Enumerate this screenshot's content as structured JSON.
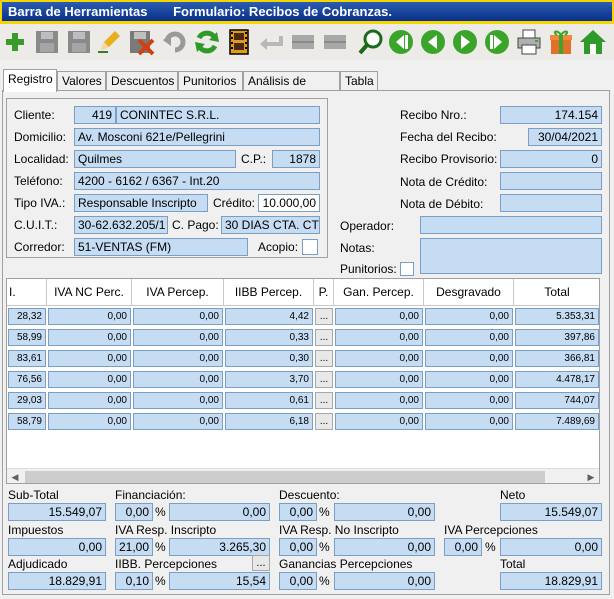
{
  "title": {
    "left": "Barra de Herramientas",
    "right": "Formulario: Recibos de Cobranzas."
  },
  "toolbar": {
    "icons": [
      "add-icon",
      "disabled-save-icon",
      "disabled-save-icon",
      "edit-icon",
      "delete-icon",
      "undo-icon",
      "refresh-icon",
      "film-icon",
      "back-arrow-icon",
      "disabled-icon",
      "disabled-icon",
      "search-icon",
      "first-record-icon",
      "previous-record-icon",
      "next-record-icon",
      "last-record-icon",
      "print-icon",
      "gift-icon",
      "home-icon"
    ]
  },
  "tabs": [
    "Registro",
    "Valores",
    "Descuentos",
    "Punitorios",
    "Análisis de Pago",
    "Tabla"
  ],
  "form": {
    "cliente_label": "Cliente:",
    "cliente_code": "419",
    "cliente_name": "CONINTEC S.R.L.",
    "domicilio_label": "Domicilio:",
    "domicilio": "Av. Mosconi 621e/Pellegrini",
    "localidad_label": "Localidad:",
    "localidad": "Quilmes",
    "cp_label": "C.P.:",
    "cp": "1878",
    "telefono_label": "Teléfono:",
    "telefono": "4200 - 6162 / 6367 - Int.20",
    "tipo_iva_label": "Tipo IVA.:",
    "tipo_iva": "Responsable Inscripto",
    "credito_label": "Crédito:",
    "credito": "10.000,00",
    "cuit_label": "C.U.I.T.:",
    "cuit": "30-62.632.205/1",
    "cpago_label": "C. Pago:",
    "cpago": "30 DIAS CTA. CTE",
    "corredor_label": "Corredor:",
    "corredor": "51-VENTAS (FM)",
    "acopio_label": "Acopio:",
    "recibo_nro_label": "Recibo Nro.:",
    "recibo_nro": "174.154",
    "fecha_label": "Fecha del Recibo:",
    "fecha": "30/04/2021",
    "provisorio_label": "Recibo Provisorio:",
    "provisorio": "0",
    "nota_credito_label": "Nota de Crédito:",
    "nota_credito": "",
    "nota_debito_label": "Nota de Débito:",
    "nota_debito": "",
    "operador_label": "Operador:",
    "notas_label": "Notas:",
    "punitorios_label": "Punitorios:"
  },
  "grid": {
    "headers": [
      "I.",
      "IVA NC Perc.",
      "IVA Percep.",
      "IIBB Percep.",
      "P.",
      "Gan. Percep.",
      "Desgravado",
      "Total"
    ],
    "rows": [
      [
        "28,32",
        "0,00",
        "0,00",
        "4,42",
        "...",
        "0,00",
        "0,00",
        "5.353,31"
      ],
      [
        "58,99",
        "0,00",
        "0,00",
        "0,33",
        "...",
        "0,00",
        "0,00",
        "397,86"
      ],
      [
        "83,61",
        "0,00",
        "0,00",
        "0,30",
        "...",
        "0,00",
        "0,00",
        "366,81"
      ],
      [
        "76,56",
        "0,00",
        "0,00",
        "3,70",
        "...",
        "0,00",
        "0,00",
        "4.478,17"
      ],
      [
        "29,03",
        "0,00",
        "0,00",
        "0,61",
        "...",
        "0,00",
        "0,00",
        "744,07"
      ],
      [
        "58,79",
        "0,00",
        "0,00",
        "6,18",
        "...",
        "0,00",
        "0,00",
        "7.489,69"
      ]
    ]
  },
  "totals": {
    "subtotal_label": "Sub-Total",
    "subtotal": "15.549,07",
    "financiacion_label": "Financiación:",
    "financiacion_pct": "0,00",
    "financiacion": "0,00",
    "descuento_label": "Descuento:",
    "descuento_pct": "0,00",
    "descuento": "0,00",
    "neto_label": "Neto",
    "neto": "15.549,07",
    "impuestos_label": "Impuestos",
    "impuestos": "0,00",
    "iva_ri_label": "IVA Resp. Inscripto",
    "iva_ri_pct": "21,00",
    "iva_ri": "3.265,30",
    "iva_rni_label": "IVA Resp. No Inscripto",
    "iva_rni_pct": "0,00",
    "iva_rni": "0,00",
    "iva_perc_label": "IVA Percepciones",
    "iva_perc_pct": "0,00",
    "iva_perc": "0,00",
    "adjudicado_label": "Adjudicado",
    "adjudicado": "18.829,91",
    "iibb_label": "IIBB. Percepciones",
    "iibb_pct": "0,10",
    "iibb": "15,54",
    "ganancias_label": "Ganancias Percepciones",
    "ganancias_pct": "0,00",
    "ganancias": "0,00",
    "total_label": "Total",
    "total": "18.829,91",
    "pct_sign": "%",
    "dots": "..."
  }
}
